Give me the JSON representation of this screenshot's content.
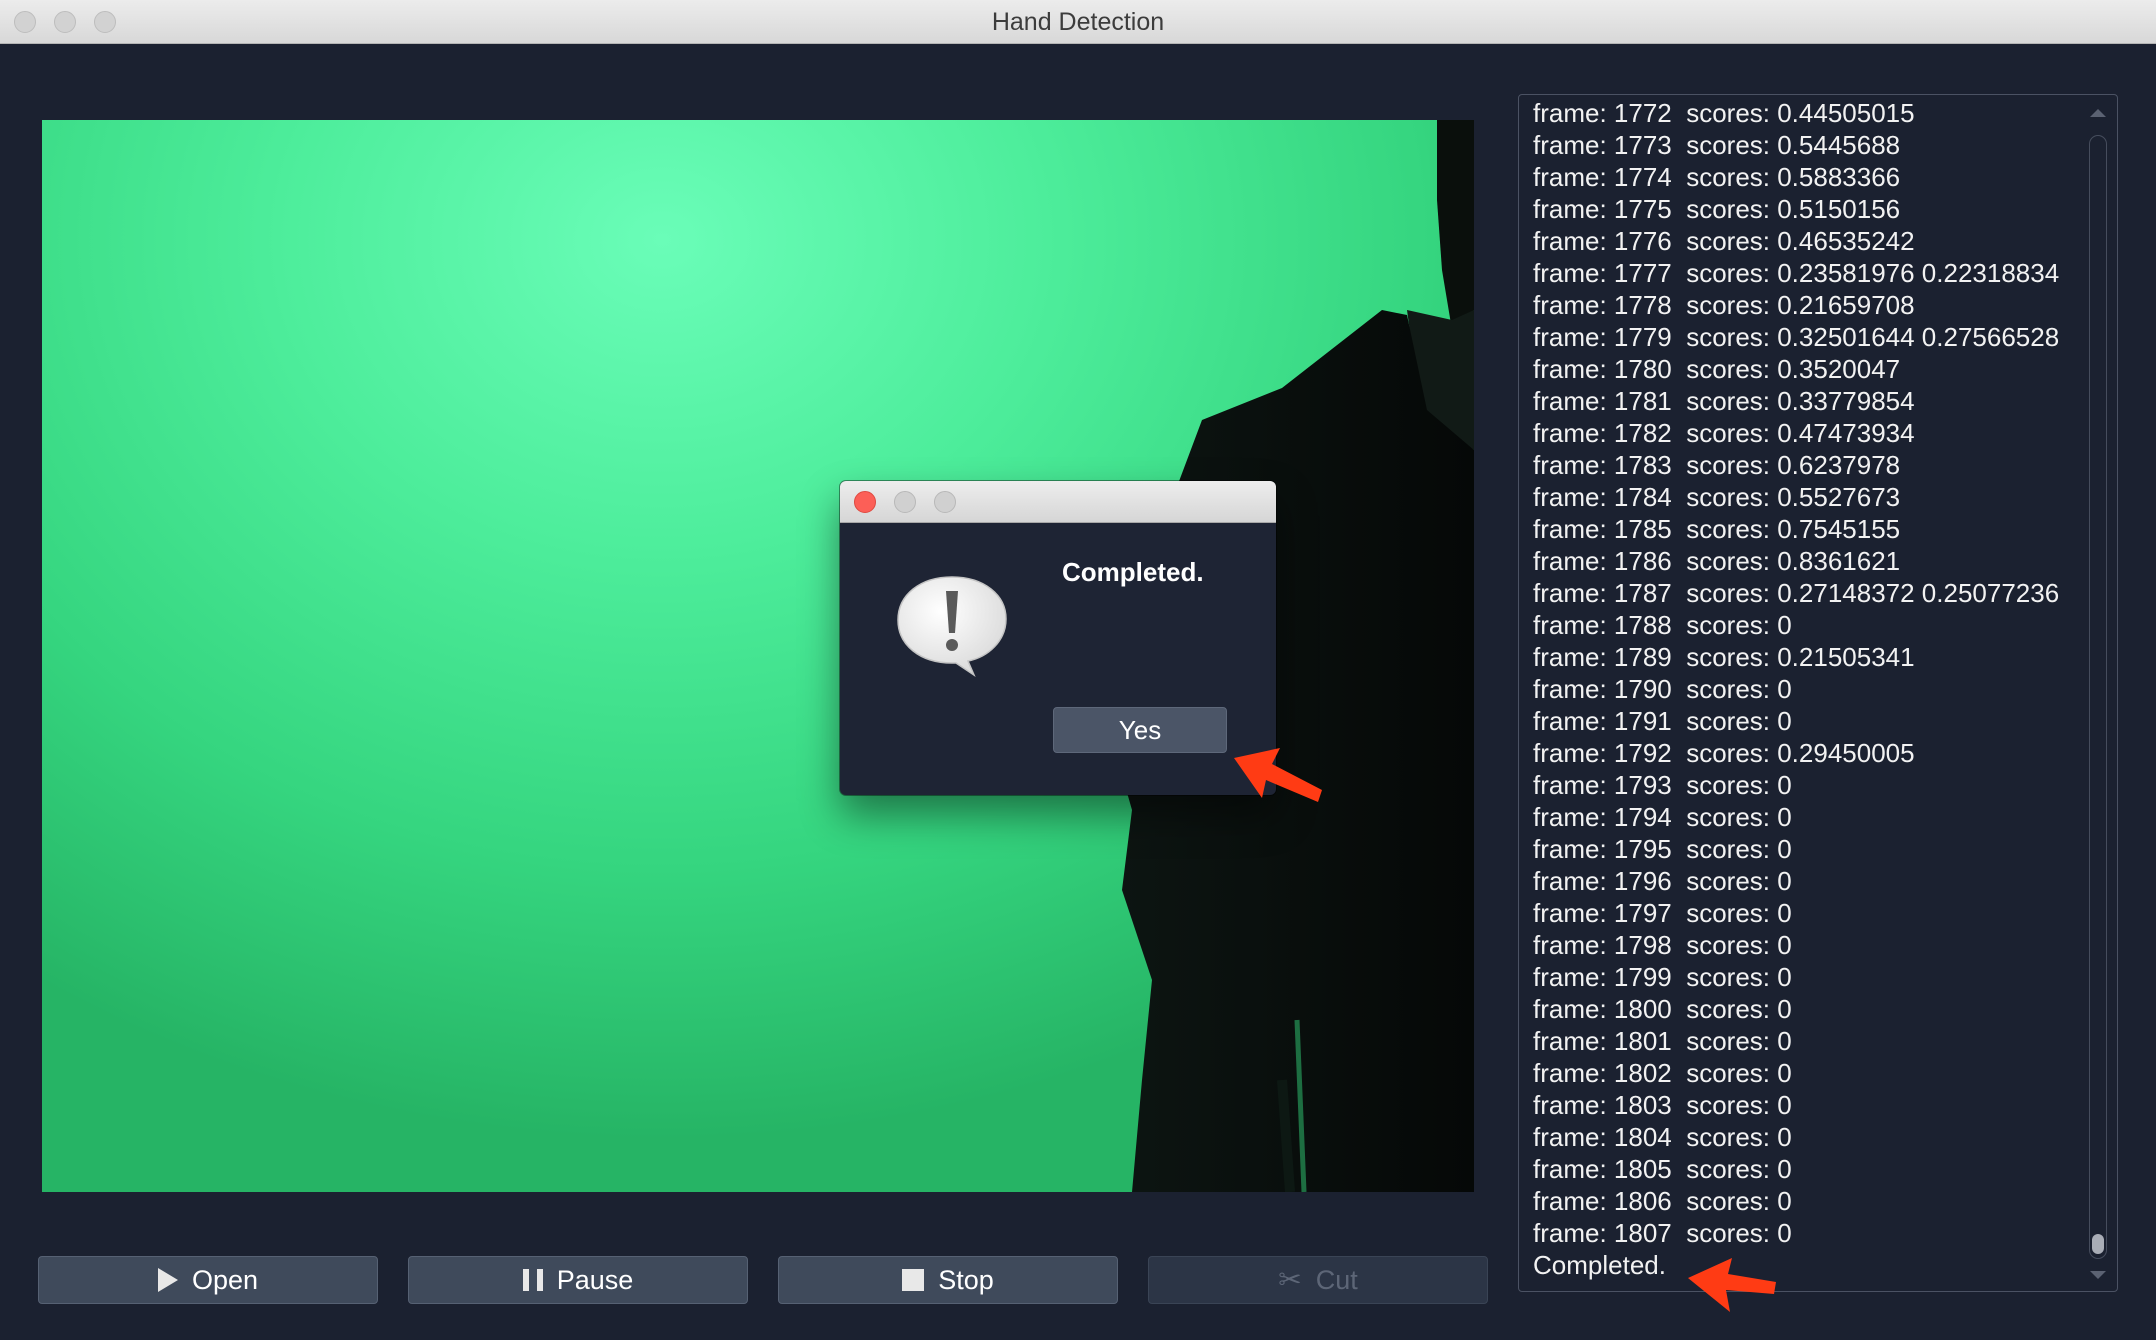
{
  "window": {
    "title": "Hand Detection"
  },
  "log": {
    "lines": [
      "frame: 1772  scores: 0.44505015",
      "frame: 1773  scores: 0.5445688",
      "frame: 1774  scores: 0.5883366",
      "frame: 1775  scores: 0.5150156",
      "frame: 1776  scores: 0.46535242",
      "frame: 1777  scores: 0.23581976 0.22318834",
      "frame: 1778  scores: 0.21659708",
      "frame: 1779  scores: 0.32501644 0.27566528",
      "frame: 1780  scores: 0.3520047",
      "frame: 1781  scores: 0.33779854",
      "frame: 1782  scores: 0.47473934",
      "frame: 1783  scores: 0.6237978",
      "frame: 1784  scores: 0.5527673",
      "frame: 1785  scores: 0.7545155",
      "frame: 1786  scores: 0.8361621",
      "frame: 1787  scores: 0.27148372 0.25077236",
      "frame: 1788  scores: 0",
      "frame: 1789  scores: 0.21505341",
      "frame: 1790  scores: 0",
      "frame: 1791  scores: 0",
      "frame: 1792  scores: 0.29450005",
      "frame: 1793  scores: 0",
      "frame: 1794  scores: 0",
      "frame: 1795  scores: 0",
      "frame: 1796  scores: 0",
      "frame: 1797  scores: 0",
      "frame: 1798  scores: 0",
      "frame: 1799  scores: 0",
      "frame: 1800  scores: 0",
      "frame: 1801  scores: 0",
      "frame: 1802  scores: 0",
      "frame: 1803  scores: 0",
      "frame: 1804  scores: 0",
      "frame: 1805  scores: 0",
      "frame: 1806  scores: 0",
      "frame: 1807  scores: 0",
      "Completed."
    ]
  },
  "controls": {
    "open": {
      "label": "Open",
      "icon": "play-icon"
    },
    "pause": {
      "label": "Pause",
      "icon": "pause-icon"
    },
    "stop": {
      "label": "Stop",
      "icon": "stop-icon"
    },
    "cut": {
      "label": "Cut",
      "icon": "scissors-icon",
      "enabled": false
    }
  },
  "dialog": {
    "message": "Completed.",
    "yes_label": "Yes",
    "icon": "warning-speech-bubble-icon"
  },
  "colors": {
    "background": "#1b2130",
    "video_green": "#4ded9b",
    "button": "#3f4a5b",
    "annotation_arrow": "#ff3b14",
    "close_red": "#fc5f57"
  }
}
